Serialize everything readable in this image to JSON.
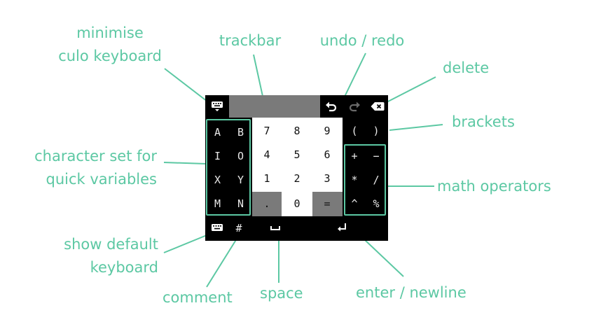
{
  "labels": {
    "minimise": [
      "minimise",
      "culo keyboard"
    ],
    "trackbar": "trackbar",
    "undo_redo": "undo / redo",
    "delete": "delete",
    "brackets": "brackets",
    "charset": [
      "character set for",
      "quick variables"
    ],
    "math": "math operators",
    "show_default": [
      "show default",
      "keyboard"
    ],
    "comment": "comment",
    "space": "space",
    "enter": "enter / newline"
  },
  "keyboard": {
    "letters": [
      [
        "A",
        "B"
      ],
      [
        "I",
        "O"
      ],
      [
        "X",
        "Y"
      ],
      [
        "M",
        "N"
      ]
    ],
    "numpad": [
      [
        "7",
        "8",
        "9"
      ],
      [
        "4",
        "5",
        "6"
      ],
      [
        "1",
        "2",
        "3"
      ],
      [
        ".",
        "0",
        "="
      ]
    ],
    "brackets": [
      "(",
      ")"
    ],
    "operators": [
      [
        "+",
        "−"
      ],
      [
        "*",
        "/"
      ],
      [
        "^",
        "%"
      ]
    ],
    "bottom": {
      "hash": "#"
    }
  },
  "colors": {
    "accent": "#5cc8a3",
    "keyboard_bg": "#000000",
    "numpad_bg": "#ffffff",
    "trackbar": "#7a7a7a",
    "special_key": "#7a7a7a",
    "dim_icon": "#6a6a6a"
  },
  "icons": {
    "minimise": "keyboard-down-icon",
    "undo": "undo-icon",
    "redo": "redo-icon",
    "delete": "backspace-icon",
    "show_default": "keyboard-icon",
    "space": "space-bar-icon",
    "enter": "enter-return-icon"
  }
}
